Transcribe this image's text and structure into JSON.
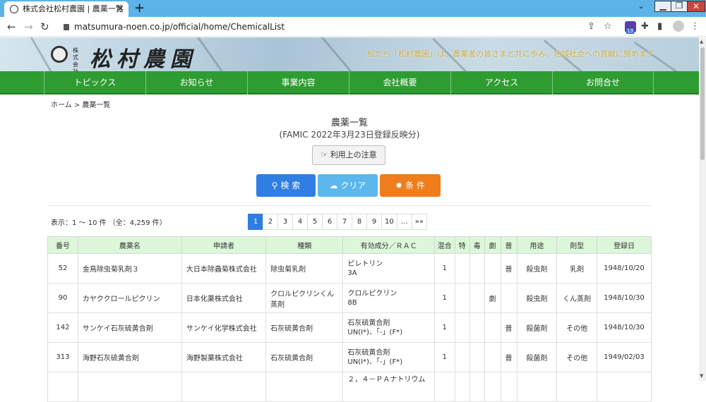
{
  "browser": {
    "tab_title": "株式会社松村農園 | 農薬一覧",
    "url": "matsumura-noen.co.jp/official/home/ChemicalList",
    "ext_badge": "13"
  },
  "header": {
    "logo_kaisha": "株式会社",
    "logo_name": "松村農園",
    "slogan": "私たち「松村農園」は、農業者の皆さまと共に歩み、地域社会への貢献に努めます"
  },
  "gnav": [
    "トピックス",
    "お知らせ",
    "事業内容",
    "会社概要",
    "アクセス",
    "お問合せ"
  ],
  "breadcrumb": "ホーム > 農薬一覧",
  "page": {
    "title": "農薬一覧",
    "subtitle": "(FAMIC 2022年3月23日登録反映分)",
    "notice_label": "利用上の注意",
    "search_label": "検 索",
    "clear_label": "クリア",
    "cond_label": "条 件",
    "count_text": "表示：1 〜 10 件 （全：4,259 件）"
  },
  "pager": [
    "1",
    "2",
    "3",
    "4",
    "5",
    "6",
    "7",
    "8",
    "9",
    "10",
    "…",
    "»»"
  ],
  "table": {
    "headers": [
      "番号",
      "農薬名",
      "申請者",
      "種類",
      "有効成分／ＲＡＣ",
      "混合",
      "特",
      "毒",
      "劇",
      "普",
      "用途",
      "剤型",
      "登録日"
    ],
    "rows": [
      {
        "no": "52",
        "name": "金鳥除虫菊乳剤３",
        "applicant": "大日本除蟲菊株式会社",
        "kind": "除虫菊乳剤",
        "ing1": "ピレトリン",
        "ing2": "3A",
        "mix": "1",
        "toku": "",
        "doku": "",
        "geki": "",
        "fu": "普",
        "use": "殺虫剤",
        "form": "乳剤",
        "date": "1948/10/20"
      },
      {
        "no": "90",
        "name": "カヤククロールピクリン",
        "applicant": "日本化薬株式会社",
        "kind": "クロルピクリンくん蒸剤",
        "ing1": "クロルピクリン",
        "ing2": "8B",
        "mix": "1",
        "toku": "",
        "doku": "",
        "geki": "劇",
        "fu": "",
        "use": "殺虫剤",
        "form": "くん蒸剤",
        "date": "1948/10/30"
      },
      {
        "no": "142",
        "name": "サンケイ石灰硫黄合剤",
        "applicant": "サンケイ化学株式会社",
        "kind": "石灰硫黄合剤",
        "ing1": "石灰硫黄合剤",
        "ing2": "UN(I*)、「-」(F*)",
        "mix": "1",
        "toku": "",
        "doku": "",
        "geki": "",
        "fu": "普",
        "use": "殺菌剤",
        "form": "その他",
        "date": "1948/10/30"
      },
      {
        "no": "313",
        "name": "海野石灰硫黄合剤",
        "applicant": "海野製薬株式会社",
        "kind": "石灰硫黄合剤",
        "ing1": "石灰硫黄合剤",
        "ing2": "UN(I*)、「-」(F*)",
        "mix": "1",
        "toku": "",
        "doku": "",
        "geki": "",
        "fu": "普",
        "use": "殺菌剤",
        "form": "その他",
        "date": "1949/02/03"
      },
      {
        "no": "",
        "name": "",
        "applicant": "",
        "kind": "",
        "ing1": "２，４－ＰＡナトリウム",
        "ing2": "",
        "mix": "",
        "toku": "",
        "doku": "",
        "geki": "",
        "fu": "",
        "use": "",
        "form": "",
        "date": ""
      }
    ]
  },
  "colors": {
    "nav_green": "#2f9c32",
    "search_blue": "#2f7ee3",
    "clear_blue": "#5bb7ec",
    "cond_orange": "#f07d1c",
    "th_bg": "#dcf7d9"
  }
}
